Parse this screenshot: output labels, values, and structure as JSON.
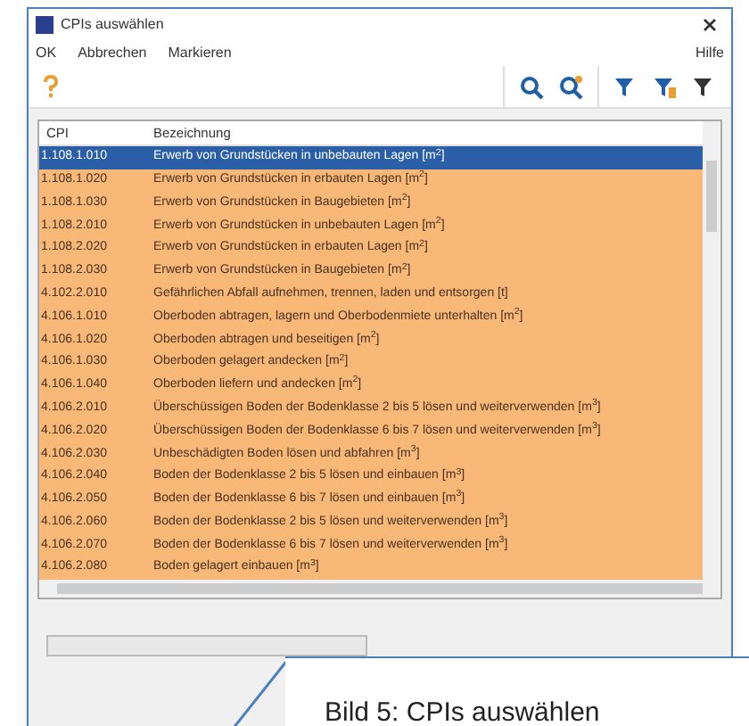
{
  "window": {
    "title": "CPIs auswählen"
  },
  "menu": [
    {
      "label": "OK"
    },
    {
      "label": "Abbrechen"
    },
    {
      "label": "Markieren"
    }
  ],
  "menu_right": {
    "label": "Hilfe"
  },
  "table": {
    "columns": [
      "CPI",
      "Bezeichnung"
    ],
    "rows": [
      {
        "cpi": "1.108.1.010",
        "text": "Erwerb von Grundstücken in unbebauten Lagen [m$^{2}$]",
        "selected": true
      },
      {
        "cpi": "1.108.1.020",
        "text": "Erwerb von Grundstücken in erbauten Lagen [m$^{2}$]",
        "selected": false
      },
      {
        "cpi": "1.108.1.030",
        "text": "Erwerb von Grundstücken in Baugebieten [m$^{2}$]",
        "selected": false
      },
      {
        "cpi": "1.108.2.010",
        "text": "Erwerb von Grundstücken in unbebauten Lagen [m$^{2}$]",
        "selected": false
      },
      {
        "cpi": "1.108.2.020",
        "text": "Erwerb von Grundstücken in erbauten Lagen [m$^{2}$]",
        "selected": false
      },
      {
        "cpi": "1.108.2.030",
        "text": "Erwerb von Grundstücken in Baugebieten [m$^{2}$]",
        "selected": false
      },
      {
        "cpi": "4.102.2.010",
        "text": "Gefährlichen Abfall aufnehmen, trennen, laden und entsorgen [t]",
        "selected": false
      },
      {
        "cpi": "4.106.1.010",
        "text": "Oberboden abtragen, lagern und Oberbodenmiete unterhalten [m$^{2}$]",
        "selected": false
      },
      {
        "cpi": "4.106.1.020",
        "text": "Oberboden abtragen und beseitigen [m$^{2}$]",
        "selected": false
      },
      {
        "cpi": "4.106.1.030",
        "text": "Oberboden gelagert andecken [m$^{2}$]",
        "selected": false
      },
      {
        "cpi": "4.106.1.040",
        "text": "Oberboden liefern und andecken [m$^{2}$]",
        "selected": false
      },
      {
        "cpi": "4.106.2.010",
        "text": "Überschüssigen Boden der Bodenklasse 2 bis 5 lösen und weiterverwenden [m$^{3}$]",
        "selected": false
      },
      {
        "cpi": "4.106.2.020",
        "text": "Überschüssigen Boden der Bodenklasse 6 bis 7 lösen und weiterverwenden [m$^{3}$]",
        "selected": false
      },
      {
        "cpi": "4.106.2.030",
        "text": "Unbeschädigten Boden lösen und abfahren [m$^{3}$]",
        "selected": false
      },
      {
        "cpi": "4.106.2.040",
        "text": "Boden der Bodenklasse 2 bis 5 lösen und einbauen [m$^{3}$]",
        "selected": false
      },
      {
        "cpi": "4.106.2.050",
        "text": "Boden der Bodenklasse 6 bis 7 lösen und einbauen [m$^{3}$]",
        "selected": false
      },
      {
        "cpi": "4.106.2.060",
        "text": "Boden der Bodenklasse 2 bis 5 lösen und weiterverwenden [m$^{3}$]",
        "selected": false
      },
      {
        "cpi": "4.106.2.070",
        "text": "Boden der Bodenklasse 6 bis 7 lösen und weiterverwenden [m$^{3}$]",
        "selected": false
      },
      {
        "cpi": "4.106.2.080",
        "text": "Boden gelagert einbauen [m$^{3}$]",
        "selected": false
      }
    ]
  },
  "caption": "Bild 5: CPIs auswählen"
}
